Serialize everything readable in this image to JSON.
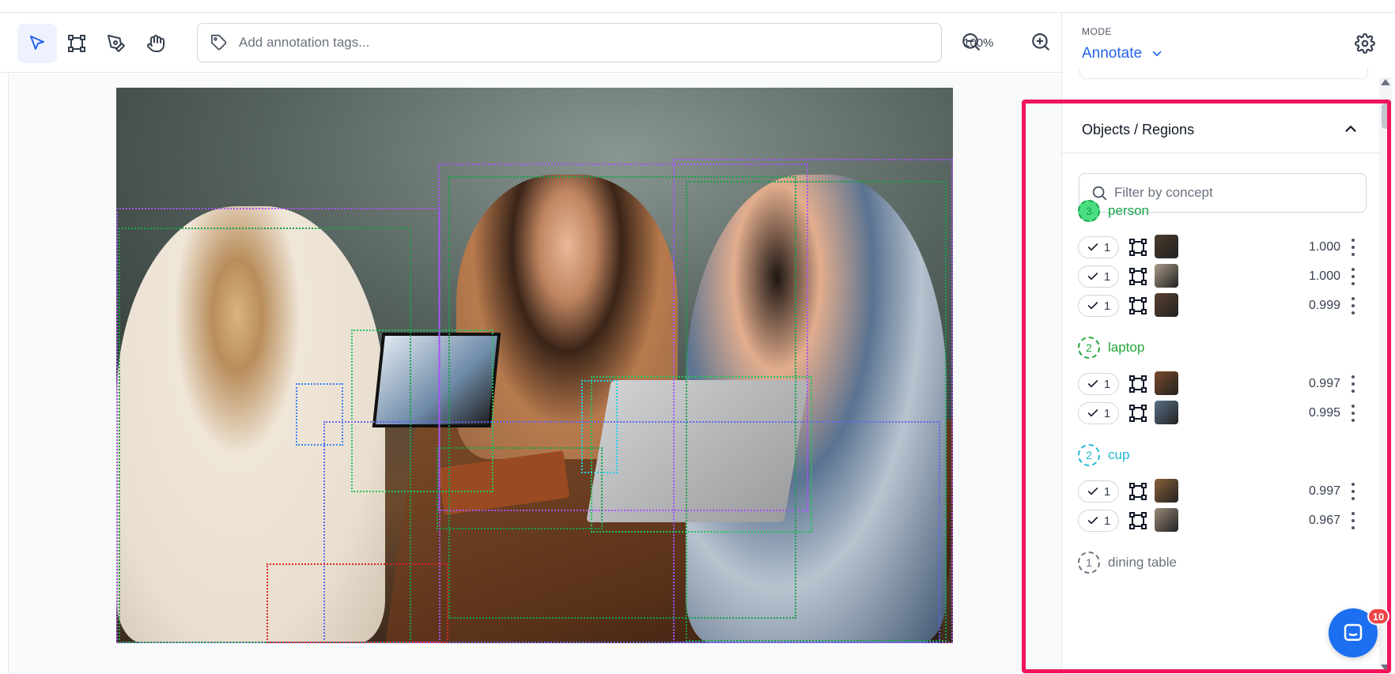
{
  "toolbar": {
    "tools": [
      {
        "name": "select-tool",
        "icon": "cursor-arrow-icon",
        "active": true
      },
      {
        "name": "bbox-tool",
        "icon": "bounding-box-icon",
        "active": false
      },
      {
        "name": "polygon-tool",
        "icon": "pen-tool-icon",
        "active": false
      },
      {
        "name": "pan-tool",
        "icon": "hand-icon",
        "active": false
      }
    ],
    "tags_placeholder": "Add annotation tags...",
    "zoom_level": "100%"
  },
  "sidebar": {
    "mode_label": "MODE",
    "mode_value": "Annotate",
    "objects_title": "Objects / Regions",
    "filter_placeholder": "Filter by concept",
    "concepts": [
      {
        "label": "person",
        "count": "3",
        "color": "#16a34a",
        "badge_fill": "#4ade80",
        "items": [
          {
            "verified": "1",
            "score": "1.000",
            "thumb_color": "#4a3a2c"
          },
          {
            "verified": "1",
            "score": "1.000",
            "thumb_color": "#a89a88"
          },
          {
            "verified": "1",
            "score": "0.999",
            "thumb_color": "#5a4030"
          }
        ]
      },
      {
        "label": "laptop",
        "count": "2",
        "color": "#22a83a",
        "badge_fill": "#ffffff",
        "items": [
          {
            "verified": "1",
            "score": "0.997",
            "thumb_color": "#7a4a2a"
          },
          {
            "verified": "1",
            "score": "0.995",
            "thumb_color": "#5a7088"
          }
        ]
      },
      {
        "label": "cup",
        "count": "2",
        "color": "#22b8d8",
        "badge_fill": "#ffffff",
        "items": [
          {
            "verified": "1",
            "score": "0.997",
            "thumb_color": "#8a6038"
          },
          {
            "verified": "1",
            "score": "0.967",
            "thumb_color": "#9a8a78"
          }
        ]
      },
      {
        "label": "dining table",
        "count": "1",
        "color": "#6b7280",
        "badge_fill": "#ffffff",
        "items": []
      }
    ]
  },
  "chat": {
    "badge_count": "10"
  },
  "colors": {
    "accent": "#2563eb",
    "highlight": "#f0145a",
    "person_box": "#a855f7",
    "laptop_box": "#22c55e",
    "cup_box": "#3b82f6"
  }
}
